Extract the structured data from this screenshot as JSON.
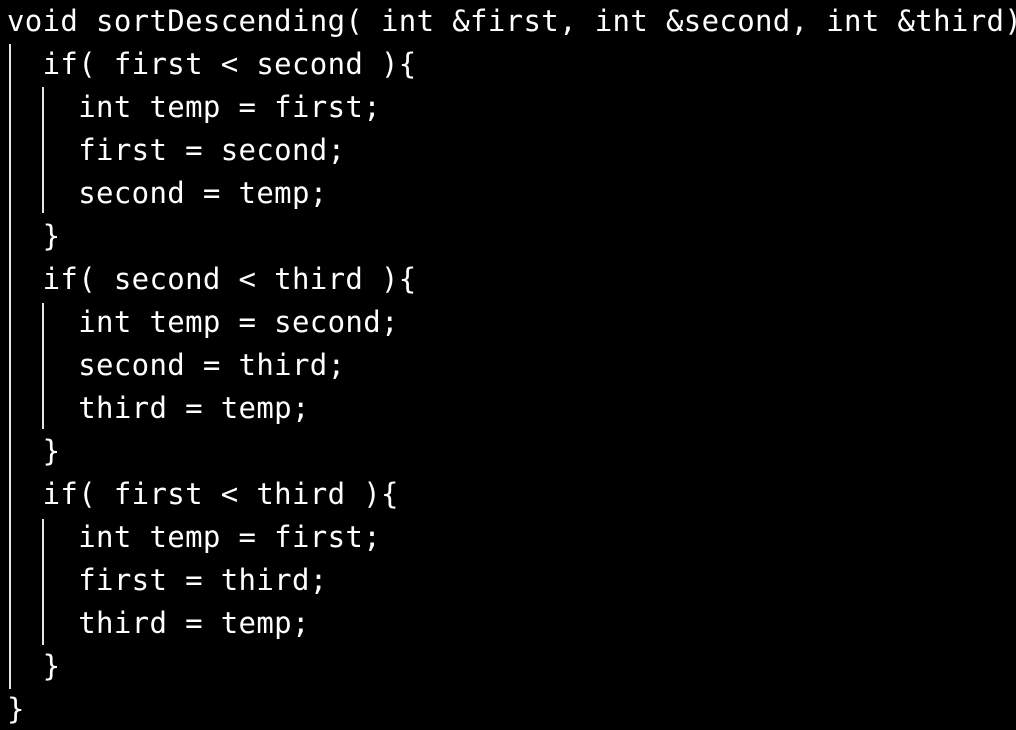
{
  "editor": {
    "theme_colors": {
      "background": "#000000",
      "text": "#ffffff",
      "indent_guide": "#e6e6e6"
    },
    "lines": [
      "void sortDescending( int &first, int &second, int &third){",
      "  if( first < second ){",
      "    int temp = first;",
      "    first = second;",
      "    second = temp;",
      "  }",
      "  if( second < third ){",
      "    int temp = second;",
      "    second = third;",
      "    third = temp;",
      "  }",
      "  if( first < third ){",
      "    int temp = first;",
      "    first = third;",
      "    third = temp;",
      "  }",
      "}"
    ]
  }
}
